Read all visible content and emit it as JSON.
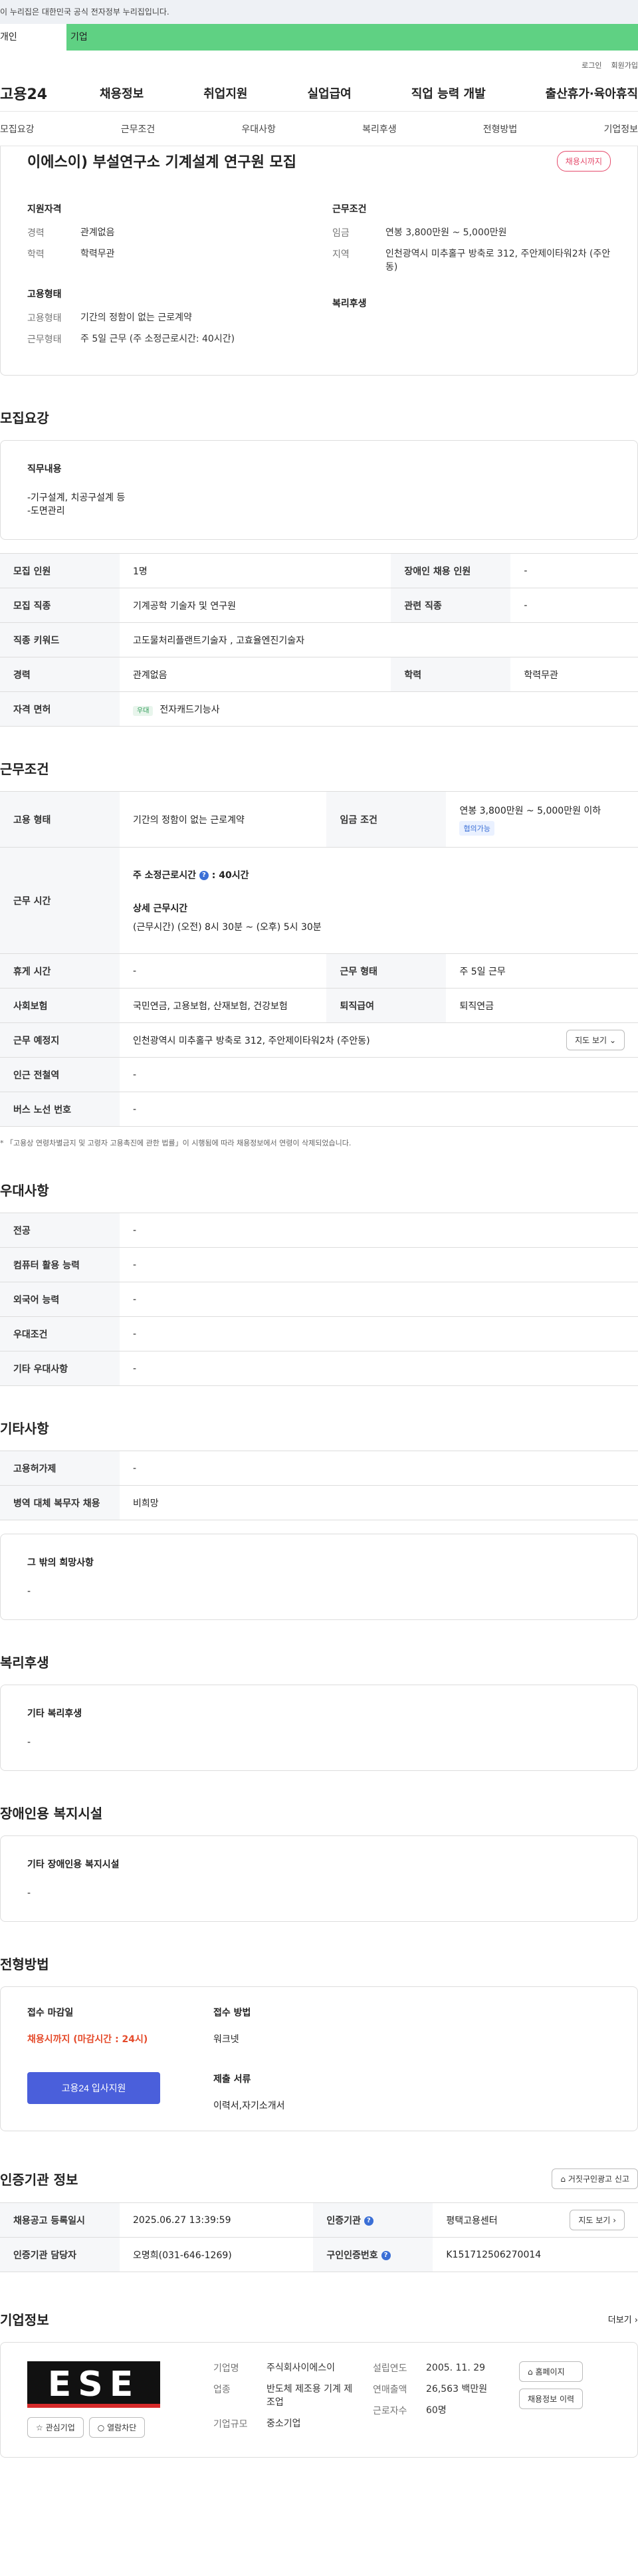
{
  "gov_bar": {
    "text": "이 누리집은 대한민국 공식 전자정부 누리집입니다."
  },
  "tabs": [
    "개인",
    "기업"
  ],
  "util": [
    "로그인",
    "회원가입"
  ],
  "gnb": {
    "logo": "고용24",
    "menu": [
      "채용정보",
      "취업지원",
      "실업급여",
      "직업 능력 개발",
      "출산휴가·육아휴직"
    ]
  },
  "subnav": [
    "모집요강",
    "근무조건",
    "우대사항",
    "복리후생",
    "전형방법",
    "기업정보"
  ],
  "job": {
    "title": "이에스이) 부설연구소 기계설계 연구원 모집",
    "status": "채용시까지",
    "qual_h": "지원자격",
    "qual": [
      {
        "k": "경력",
        "v": "관계없음"
      },
      {
        "k": "학력",
        "v": "학력무관"
      }
    ],
    "cond_h": "근무조건",
    "cond": [
      {
        "k": "임금",
        "v": "연봉 3,800만원 ~ 5,000만원"
      },
      {
        "k": "지역",
        "v": "인천광역시 미추홀구 방축로 312, 주안제이타워2차 (주안동)"
      }
    ],
    "emp_h": "고용형태",
    "emp": [
      {
        "k": "고용형태",
        "v": "기간의 정함이 없는 근로계약"
      },
      {
        "k": "근무형태",
        "v": "주 5일 근무 (주 소정근로시간: 40시간)"
      }
    ],
    "welfare_h": "복리후생"
  },
  "recruit": {
    "title": "모집요강",
    "duty_h": "직무내용",
    "duty_lines": [
      "-기구설계, 치공구설계 등",
      "-도면관리"
    ],
    "rows": [
      {
        "a": "모집 인원",
        "b": "1명",
        "c": "장애인 채용 인원",
        "d": "-"
      },
      {
        "a": "모집 직종",
        "b": "기계공학 기술자 및 연구원",
        "c": "관련 직종",
        "d": "-"
      },
      {
        "a": "직종 키워드",
        "b": "고도물처리플랜트기술자 , 고효율엔진기술자"
      },
      {
        "a": "경력",
        "b": "관계없음",
        "c": "학력",
        "d": "학력무관"
      },
      {
        "a": "자격 면허",
        "tag": "우대",
        "b": "전자캐드기능사"
      }
    ]
  },
  "work": {
    "title": "근무조건",
    "emp_type_h": "고용 형태",
    "emp_type": "기간의 정함이 없는 근로계약",
    "wage_h": "임금 조건",
    "wage": "연봉 3,800만원 ~ 5,000만원 이하",
    "wage_tag": "협의가능",
    "hours_h": "근무 시간",
    "hours_week": "주 소정근로시간",
    "hours_week_v": ": 40시간",
    "hours_detail_h": "상세 근무시간",
    "hours_detail": "(근무시간) (오전) 8시 30분 ~ (오후) 5시 30분",
    "rest_h": "휴게 시간",
    "rest": "-",
    "form_h": "근무 형태",
    "form": "주 5일 근무",
    "ins_h": "사회보험",
    "ins": "국민연금, 고용보험, 산재보험, 건강보험",
    "sev_h": "퇴직급여",
    "sev": "퇴직연금",
    "place_h": "근무 예정지",
    "place": "인천광역시 미추홀구 방축로 312, 주안제이타워2차 (주안동)",
    "map_btn": "지도 보기",
    "station_h": "인근 전철역",
    "station": "-",
    "bus_h": "버스 노선 번호",
    "bus": "-",
    "note": "* 「고용상 연령차별금지 및 고령자 고용촉진에 관한 법률」이 시행됨에 따라 채용정보에서 연령이 삭제되었습니다."
  },
  "pref": {
    "title": "우대사항",
    "rows": [
      {
        "k": "전공",
        "v": "-"
      },
      {
        "k": "컴퓨터 활용 능력",
        "v": "-"
      },
      {
        "k": "외국어 능력",
        "v": "-"
      },
      {
        "k": "우대조건",
        "v": "-"
      },
      {
        "k": "기타 우대사항",
        "v": "-"
      }
    ]
  },
  "etc": {
    "title": "기타사항",
    "rows": [
      {
        "k": "고용허가제",
        "v": "-"
      },
      {
        "k": "병역 대체 복무자 채용",
        "v": "비희망"
      }
    ],
    "other_h": "그 밖의 희망사항",
    "other": "-"
  },
  "welfare": {
    "title": "복리후생",
    "box_h": "기타 복리후생",
    "box": "-"
  },
  "disabled": {
    "title": "장애인용 복지시설",
    "box_h": "기타 장애인용 복지시설",
    "box": "-"
  },
  "apply": {
    "title": "전형방법",
    "deadline_h": "접수 마감일",
    "deadline": "채용시까지 (마감시간 : 24시)",
    "btn": "고용24 입사지원",
    "method_h": "접수 방법",
    "method": "워크넷",
    "docs_h": "제출 서류",
    "docs": "이력서,자기소개서"
  },
  "agency": {
    "title": "인증기관 정보",
    "report_btn": "거짓구인광고 신고",
    "rows": [
      {
        "a": "채용공고 등록일시",
        "b": "2025.06.27 13:39:59",
        "c": "인증기관",
        "d": "평택고용센터",
        "btn": "지도 보기"
      },
      {
        "a": "인증기관 담당자",
        "b": "오명희(031-646-1269)",
        "c": "구인인증번호",
        "d": "K151712506270014"
      }
    ]
  },
  "company": {
    "title": "기업정보",
    "more": "더보기",
    "logo_text": "ESE",
    "fav": "관심기업",
    "block": "열람차단",
    "c1": [
      {
        "k": "기업명",
        "v": "주식회사이에스이"
      },
      {
        "k": "업종",
        "v": "반도체 제조용 기계 제조업"
      },
      {
        "k": "기업규모",
        "v": "중소기업"
      }
    ],
    "c2": [
      {
        "k": "설립연도",
        "v": "2005. 11. 29"
      },
      {
        "k": "연매출액",
        "v": "26,563 백만원"
      },
      {
        "k": "근로자수",
        "v": "60명"
      }
    ],
    "home_btn": "홈페이지",
    "hist_btn": "채용정보 이력"
  }
}
